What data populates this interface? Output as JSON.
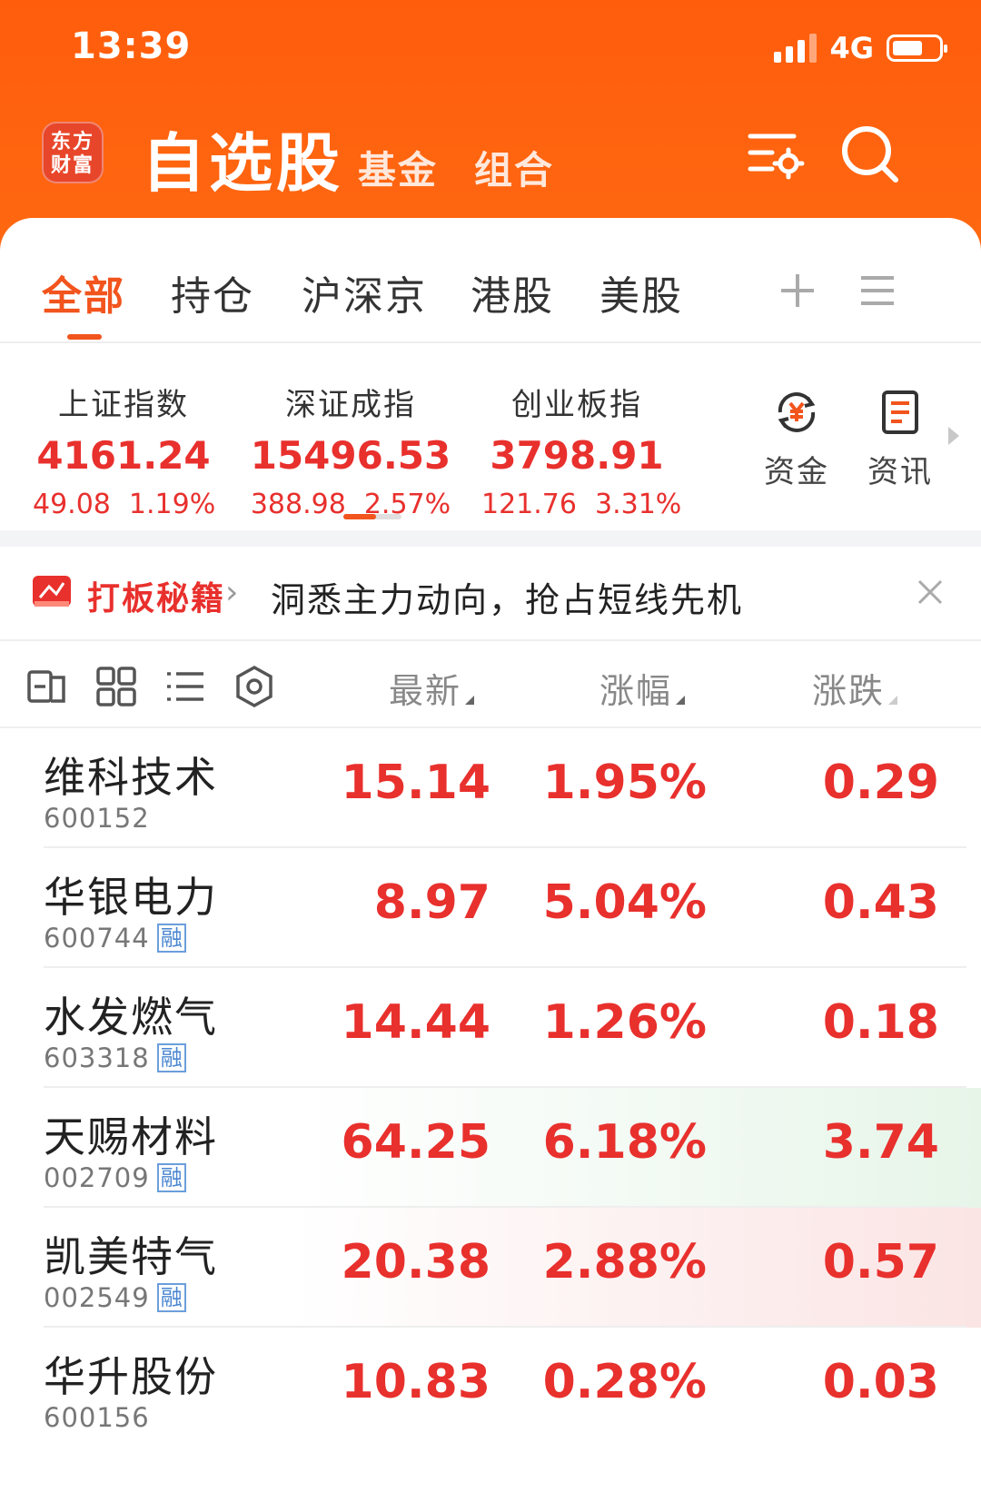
{
  "status_bar": {
    "time": "13:39",
    "network": "4G"
  },
  "header": {
    "logo_text": "东方财富",
    "title": "自选股",
    "tabs": [
      "基金",
      "组合"
    ],
    "icons": [
      "watchlist-settings-icon",
      "search-icon"
    ]
  },
  "group_tabs": {
    "items": [
      "全部",
      "持仓",
      "沪深京",
      "港股",
      "美股"
    ],
    "active": "全部",
    "icons": [
      "add-icon",
      "menu-icon"
    ]
  },
  "indices": [
    {
      "name": "上证指数",
      "value": "4161.24",
      "change": "49.08",
      "pct": "1.19%"
    },
    {
      "name": "深证成指",
      "value": "15496.53",
      "change": "388.98",
      "pct": "2.57%"
    },
    {
      "name": "创业板指",
      "value": "3798.91",
      "change": "121.76",
      "pct": "3.31%"
    }
  ],
  "shortcuts": [
    {
      "label": "资金",
      "icon": "fund-flow-icon"
    },
    {
      "label": "资讯",
      "icon": "news-icon"
    }
  ],
  "promo": {
    "brand": "打板秘籍",
    "text": "洞悉主力动向，抢占短线先机"
  },
  "list_header": {
    "columns": [
      "最新",
      "涨幅",
      "涨跌"
    ],
    "icons": [
      "card-view-icon",
      "grid-view-icon",
      "list-view-icon",
      "settings-icon"
    ]
  },
  "stocks": [
    {
      "name": "维科技术",
      "code": "600152",
      "tag": "",
      "price": "15.14",
      "pct": "1.95%",
      "chg": "0.29",
      "highlight": ""
    },
    {
      "name": "华银电力",
      "code": "600744",
      "tag": "融",
      "price": "8.97",
      "pct": "5.04%",
      "chg": "0.43",
      "highlight": ""
    },
    {
      "name": "水发燃气",
      "code": "603318",
      "tag": "融",
      "price": "14.44",
      "pct": "1.26%",
      "chg": "0.18",
      "highlight": ""
    },
    {
      "name": "天赐材料",
      "code": "002709",
      "tag": "融",
      "price": "64.25",
      "pct": "6.18%",
      "chg": "3.74",
      "highlight": "green"
    },
    {
      "name": "凯美特气",
      "code": "002549",
      "tag": "融",
      "price": "20.38",
      "pct": "2.88%",
      "chg": "0.57",
      "highlight": "red"
    },
    {
      "name": "华升股份",
      "code": "600156",
      "tag": "",
      "price": "10.83",
      "pct": "0.28%",
      "chg": "0.03",
      "highlight": ""
    }
  ],
  "colors": {
    "brand_orange": "#ff5d0c",
    "accent": "#f2541d",
    "up_red": "#e8302d",
    "tag_blue": "#4a86d0"
  }
}
